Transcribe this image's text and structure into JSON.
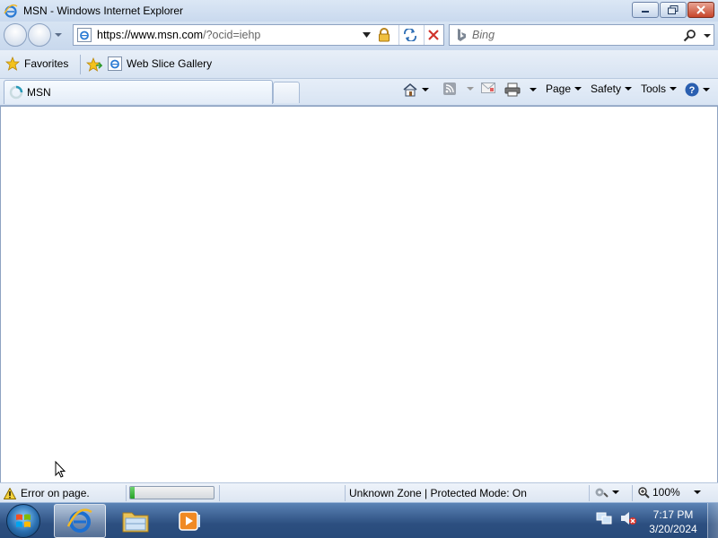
{
  "window": {
    "title": "MSN - Windows Internet Explorer"
  },
  "address": {
    "url_host": "https://www.msn.com",
    "url_rest": "/?ocid=iehp"
  },
  "search": {
    "placeholder": "Bing"
  },
  "favorites_bar": {
    "favorites_label": "Favorites",
    "web_slice_label": "Web Slice Gallery"
  },
  "tabs": [
    {
      "label": "MSN",
      "state": "loading"
    }
  ],
  "command_bar": {
    "page_label": "Page",
    "safety_label": "Safety",
    "tools_label": "Tools"
  },
  "status_bar": {
    "message": "Error on page.",
    "progress_fraction": 0.05,
    "zone": "Unknown Zone | Protected Mode: On",
    "zoom": "100%"
  },
  "taskbar": {
    "clock_time": "7:17 PM",
    "clock_date": "3/20/2024",
    "items": [
      "internet-explorer",
      "windows-explorer",
      "windows-media-player"
    ]
  },
  "colors": {
    "accent_blue": "#2c4f80",
    "progress_green": "#27a327",
    "close_red": "#c7452b"
  }
}
